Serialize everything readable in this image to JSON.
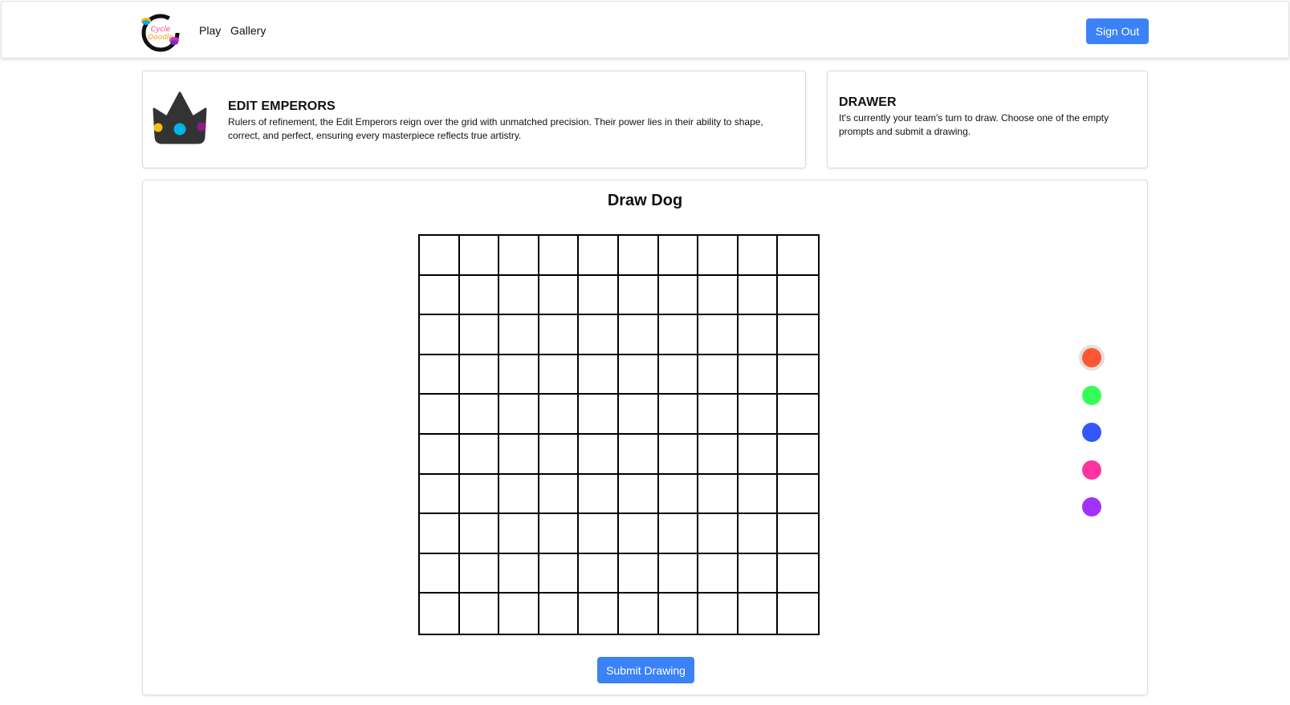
{
  "nav": {
    "logo_text": "Cycle Doodle",
    "links": [
      "Play",
      "Gallery"
    ],
    "signout_label": "Sign Out"
  },
  "team": {
    "name": "EDIT EMPERORS",
    "description": "Rulers of refinement, the Edit Emperors reign over the grid with unmatched precision. Their power lies in their ability to shape, correct, and perfect, ensuring every masterpiece reflects true artistry.",
    "icon": "crown-icon"
  },
  "role": {
    "title": "DRAWER",
    "description": "It's currently your team's turn to draw. Choose one of the empty prompts and submit a drawing."
  },
  "canvas": {
    "prompt": "Draw Dog",
    "rows": 10,
    "cols": 10
  },
  "palette": {
    "colors": [
      "#ff5733",
      "#33ff57",
      "#3357ff",
      "#ff33a1",
      "#a133ff"
    ],
    "selected_index": 0
  },
  "actions": {
    "submit_label": "Submit Drawing"
  }
}
